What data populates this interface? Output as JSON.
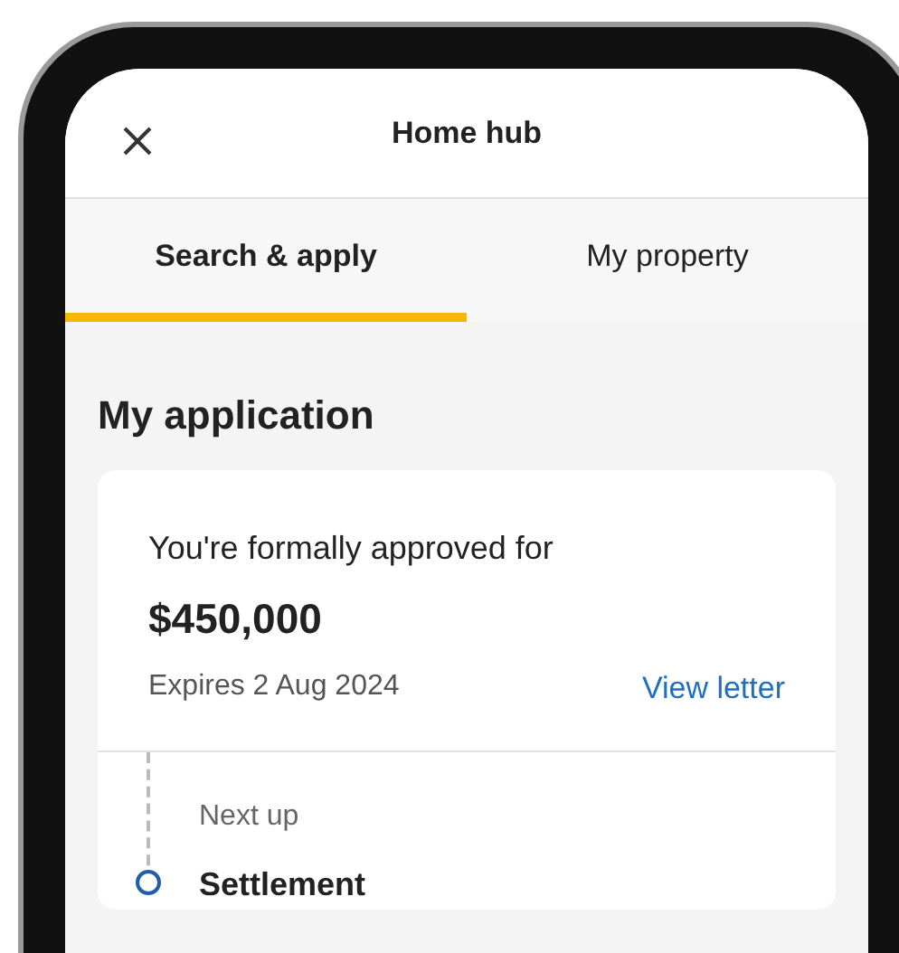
{
  "header": {
    "title": "Home hub"
  },
  "tabs": [
    {
      "label": "Search & apply",
      "selected": true
    },
    {
      "label": "My property",
      "selected": false
    }
  ],
  "section": {
    "title": "My application"
  },
  "card": {
    "approval_text": "You're formally approved for",
    "amount": "$450,000",
    "expiry": "Expires 2 Aug 2024",
    "link": "View letter"
  },
  "timeline": {
    "label": "Next up",
    "steps": [
      {
        "title": "Settlement"
      }
    ]
  }
}
